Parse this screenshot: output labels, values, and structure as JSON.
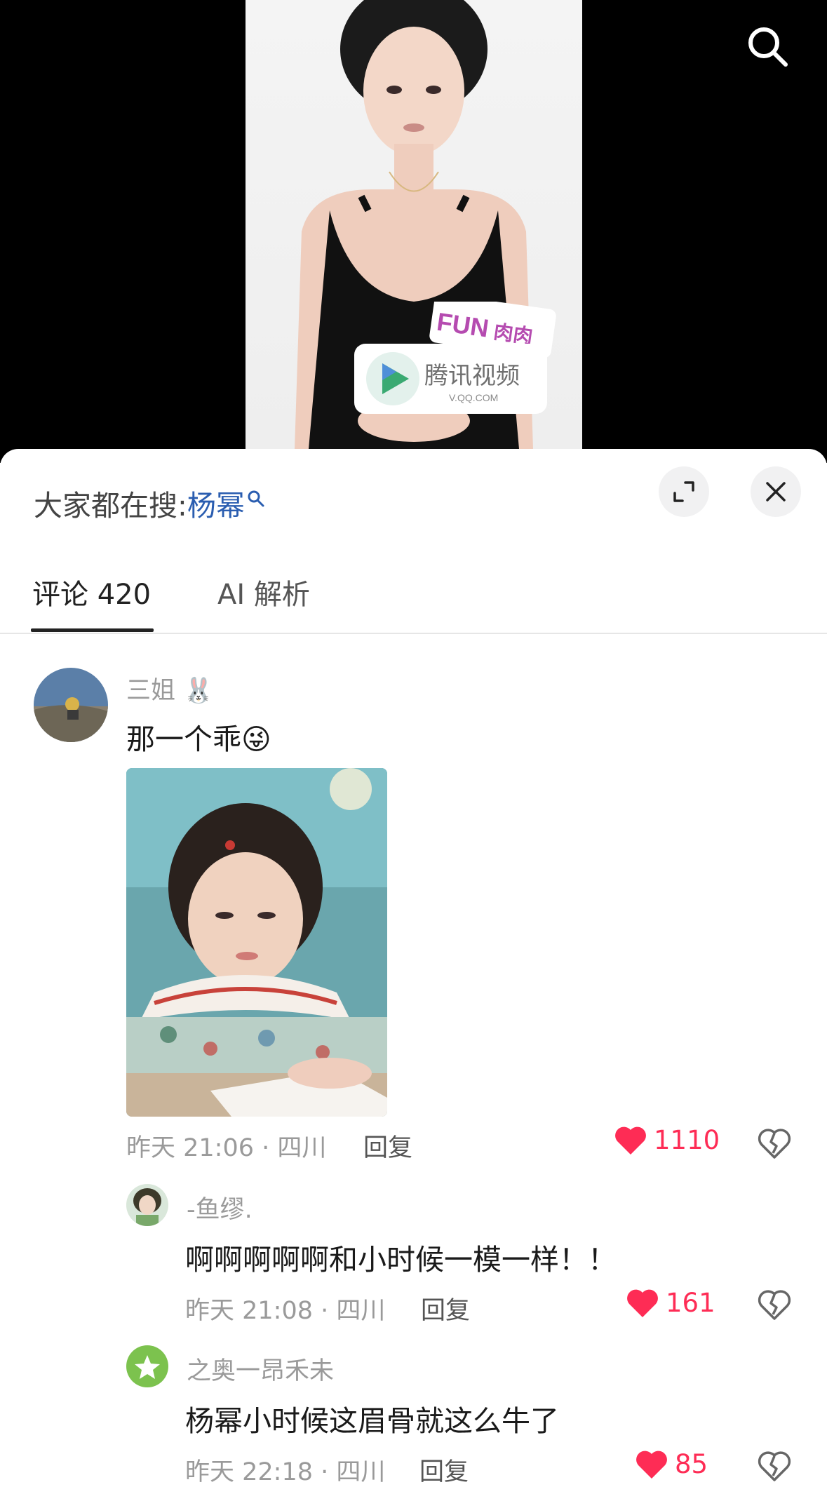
{
  "video": {
    "mic_brand_top": "FUN",
    "mic_brand_top_cn": "肉肉",
    "mic_logo_cn": "腾讯视频",
    "mic_logo_url": "V.QQ.COM"
  },
  "sheet": {
    "search_hint_label": "大家都在搜:",
    "search_hint_keyword": "杨幂"
  },
  "tabs": [
    {
      "label": "评论 420",
      "active": true
    },
    {
      "label": "AI 解析",
      "active": false
    }
  ],
  "comments": [
    {
      "username": "三姐 🐰",
      "content": "那一个乖😜",
      "meta": "昨天 21:06 · 四川",
      "reply": "回复",
      "likes": "1110"
    },
    {
      "username": "-鱼缪.",
      "content": "啊啊啊啊啊和小时候一模一样！！",
      "meta": "昨天 21:08 · 四川",
      "reply": "回复",
      "likes": "161"
    },
    {
      "username": "之奥一昂禾未",
      "content": "杨幂小时候这眉骨就这么牛了",
      "meta": "昨天 22:18 · 四川",
      "reply": "回复",
      "likes": "85"
    }
  ],
  "colors": {
    "accent_like": "#fe2c55",
    "keyword_blue": "#2a5db0"
  },
  "icons": {
    "video_search": "search-icon",
    "expand": "expand-icon",
    "close": "close-icon",
    "like": "heart-icon",
    "dislike": "broken-heart-icon"
  }
}
